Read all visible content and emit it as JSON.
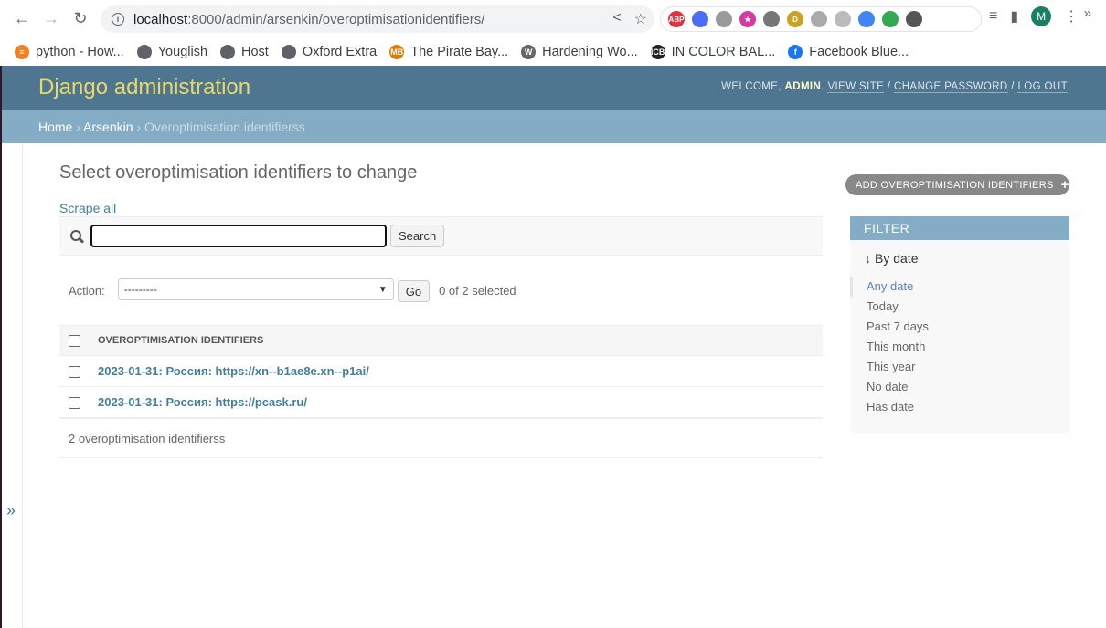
{
  "browser": {
    "url_host": "localhost",
    "url_rest": ":8000/admin/arsenkin/overoptimisationidentifiers/",
    "profile_initial": "M",
    "extensions": [
      {
        "name": "adblock-plus-icon",
        "label": "ABP",
        "color": "#e0333e"
      },
      {
        "name": "color-picker-icon",
        "label": "",
        "color": "#4a6cf7"
      },
      {
        "name": "ruler-icon",
        "label": "",
        "color": "#9a9a9a"
      },
      {
        "name": "stars-icon",
        "label": "★",
        "color": "#d43aa0"
      },
      {
        "name": "bookmark-icon",
        "label": "",
        "color": "#777777"
      },
      {
        "name": "d-coin-icon",
        "label": "D",
        "color": "#c9a227"
      },
      {
        "name": "note-icon",
        "label": "",
        "color": "#aaaaaa"
      },
      {
        "name": "globe-grid-icon",
        "label": "",
        "color": "#bbbbbb"
      },
      {
        "name": "doc-download-icon",
        "label": "",
        "color": "#4285f4"
      },
      {
        "name": "target-icon",
        "label": "",
        "color": "#34a853"
      },
      {
        "name": "puzzle-icon",
        "label": "",
        "color": "#555555"
      }
    ],
    "bookmarks": [
      {
        "label": "python - How...",
        "icon": "stackoverflow-icon",
        "icon_text": "≡",
        "color": "#f48024"
      },
      {
        "label": "Youglish",
        "icon": "globe-icon",
        "icon_text": "",
        "color": "#5f6368"
      },
      {
        "label": "Host",
        "icon": "globe-icon",
        "icon_text": "",
        "color": "#5f6368"
      },
      {
        "label": "Oxford Extra",
        "icon": "globe-icon",
        "icon_text": "",
        "color": "#5f6368"
      },
      {
        "label": "The Pirate Bay...",
        "icon": "mb-icon",
        "icon_text": "MB",
        "color": "#e07b00"
      },
      {
        "label": "Hardening Wo...",
        "icon": "wordpress-icon",
        "icon_text": "W",
        "color": "#666666"
      },
      {
        "label": "IN COLOR BAL...",
        "icon": "icb-icon",
        "icon_text": "ICB",
        "color": "#222222"
      },
      {
        "label": "Facebook Blue...",
        "icon": "facebook-icon",
        "icon_text": "f",
        "color": "#1877f2"
      }
    ],
    "bookmarks_more": "»"
  },
  "header": {
    "brand": "Django administration",
    "welcome": "WELCOME, ",
    "username": "ADMIN",
    "view_site": "VIEW SITE",
    "change_password": "CHANGE PASSWORD",
    "log_out": "LOG OUT",
    "sep": " / "
  },
  "breadcrumbs": {
    "home": "Home",
    "app": "Arsenkin",
    "current": "Overoptimisation identifierss",
    "sep": " › "
  },
  "content": {
    "title": "Select overoptimisation identifiers to change",
    "add_button": "ADD OVEROPTIMISATION IDENTIFIERS",
    "scrape_all": "Scrape all",
    "search_value": "",
    "search_button": "Search",
    "action_label": "Action:",
    "action_selected": "---------",
    "go_button": "Go",
    "selection_counter": "0 of 2 selected",
    "column_header": "OVEROPTIMISATION IDENTIFIERS",
    "rows": [
      {
        "label": "2023-01-31: Россия: https://xn--b1ae8e.xn--p1ai/"
      },
      {
        "label": "2023-01-31: Россия: https://pcask.ru/"
      }
    ],
    "paginator": "2 overoptimisation identifierss"
  },
  "filter": {
    "title": "FILTER",
    "subtitle": "By date",
    "options": [
      "Any date",
      "Today",
      "Past 7 days",
      "This month",
      "This year",
      "No date",
      "Has date"
    ],
    "selected": "Any date"
  },
  "nav_toggle": "»"
}
